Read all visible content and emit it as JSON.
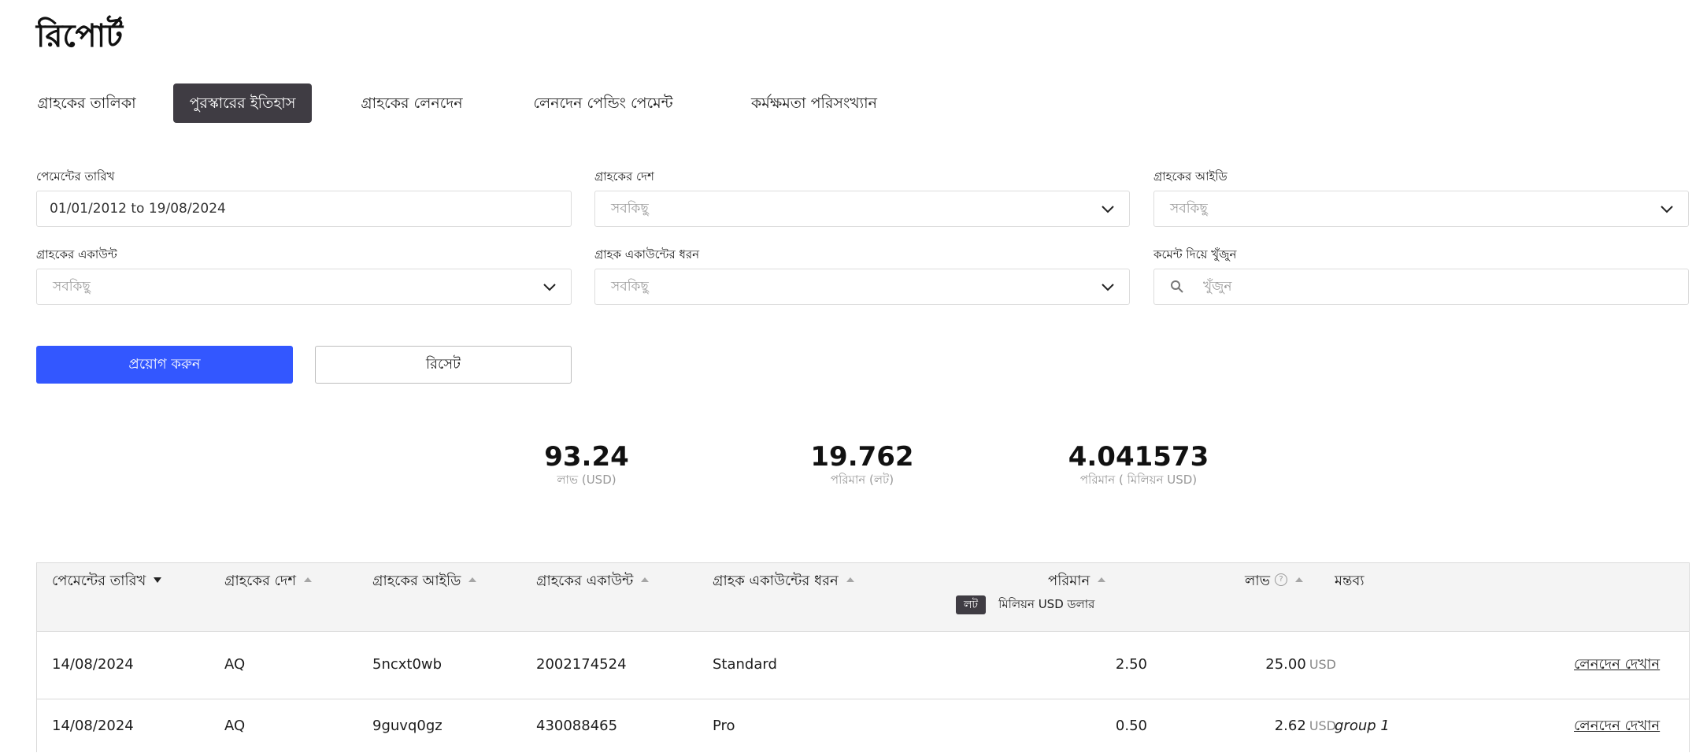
{
  "page_title": "রিপোর্ট",
  "tabs": [
    {
      "label": "গ্রাহকের তালিকা",
      "active": false
    },
    {
      "label": "পুরস্কারের ইতিহাস",
      "active": true
    },
    {
      "label": "গ্রাহকের লেনদেন",
      "active": false
    },
    {
      "label": "লেনদেন পেন্ডিং পেমেন্ট",
      "active": false
    },
    {
      "label": "কর্মক্ষমতা পরিসংখ্যান",
      "active": false
    }
  ],
  "filters": {
    "payment_date": {
      "label": "পেমেন্টের তারিখ",
      "value": "01/01/2012 to 19/08/2024"
    },
    "client_country": {
      "label": "গ্রাহকের দেশ",
      "placeholder": "সবকিছু"
    },
    "client_id": {
      "label": "গ্রাহকের আইডি",
      "placeholder": "সবকিছু"
    },
    "client_account": {
      "label": "গ্রাহকের একাউন্ট",
      "placeholder": "সবকিছু"
    },
    "account_type": {
      "label": "গ্রাহক একাউন্টের ধরন",
      "placeholder": "সবকিছু"
    },
    "comment_search": {
      "label": "কমেন্ট দিয়ে খুঁজুন",
      "placeholder": "খুঁজুন"
    }
  },
  "buttons": {
    "apply": "প্রয়োগ করুন",
    "reset": "রিসেট"
  },
  "stats": [
    {
      "value": "93.24",
      "label": "লাভ (USD)"
    },
    {
      "value": "19.762",
      "label": "পরিমান (লট)"
    },
    {
      "value": "4.041573",
      "label": "পরিমান ( মিলিয়ন USD)"
    }
  ],
  "table": {
    "columns": [
      "পেমেন্টের তারিখ",
      "গ্রাহকের দেশ",
      "গ্রাহকের আইডি",
      "গ্রাহকের একাউন্ট",
      "গ্রাহক একাউন্টের ধরন",
      "পরিমান",
      "লাভ",
      "মন্তব্য"
    ],
    "help_icon": "?",
    "unit_toggle": {
      "lot": "লট",
      "usd": "মিলিয়ন USD ডলার"
    },
    "rows": [
      {
        "date": "14/08/2024",
        "country": "AQ",
        "client_id": "5ncxt0wb",
        "account": "2002174524",
        "type": "Standard",
        "volume": "2.50",
        "profit": "25.00",
        "currency": "USD",
        "comment": "",
        "action": "লেনদেন দেখান"
      },
      {
        "date": "14/08/2024",
        "country": "AQ",
        "client_id": "9guvq0gz",
        "account": "430088465",
        "type": "Pro",
        "volume": "0.50",
        "profit": "2.62",
        "currency": "USD",
        "comment": "group 1",
        "action": "লেনদেন দেখান"
      }
    ]
  },
  "colors": {
    "accent": "#3357ff",
    "active_tab": "#3f3c43"
  },
  "icons": {
    "dropdown": "chevron-down-icon",
    "search": "search-icon",
    "sort": "sort-arrow-icon"
  }
}
